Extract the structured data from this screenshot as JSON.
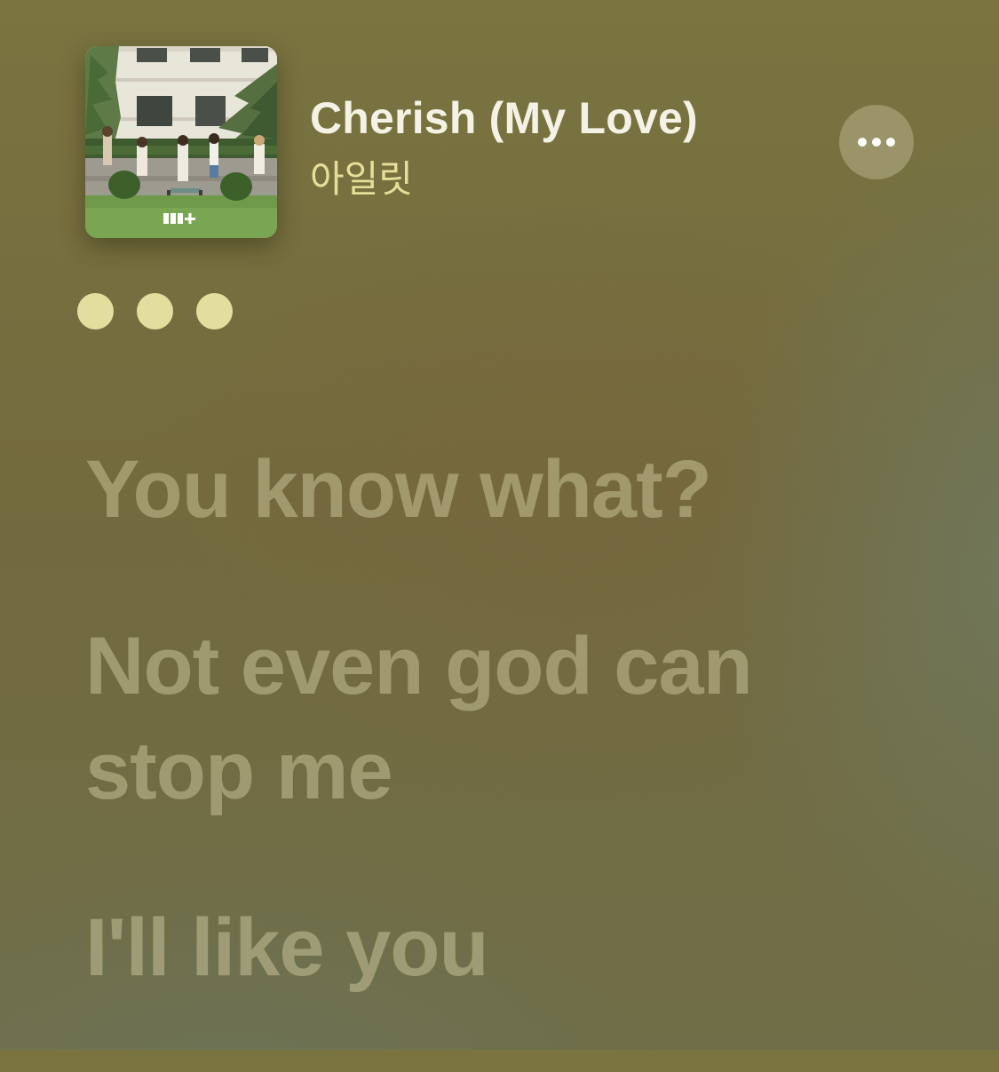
{
  "now_playing": {
    "title": "Cherish (My Love)",
    "artist": "아일릿",
    "artwork_logo": "ILLIT"
  },
  "more_button": {
    "icon": "ellipsis-icon"
  },
  "interlude": {
    "dot_count": 3,
    "dot_color": "#e2de9e"
  },
  "lyrics": [
    {
      "text": "You know what?"
    },
    {
      "text": "Not even god can\nstop me"
    },
    {
      "text": "I'll like you"
    }
  ],
  "colors": {
    "title": "#f4f2e4",
    "artist": "#e6df9a",
    "background": "#7a7440"
  }
}
